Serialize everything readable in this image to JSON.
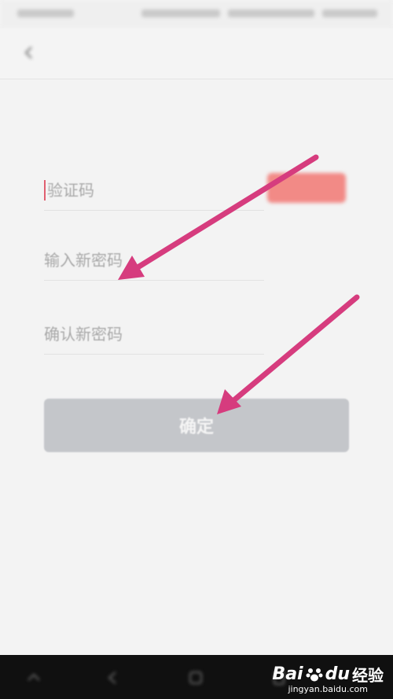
{
  "status_bar": {
    "carrier": "",
    "time": ""
  },
  "header": {
    "title": "",
    "back_icon": "chevron-left-icon"
  },
  "form": {
    "phone_hint": "",
    "code_placeholder": "验证码",
    "send_code_label": "",
    "new_password_placeholder": "输入新密码",
    "confirm_password_placeholder": "确认新密码",
    "confirm_label": "确定"
  },
  "colors": {
    "send_code_button": "#f28a86",
    "confirm_button": "#c4c6ca",
    "annotation_arrow": "#d63c7e",
    "nav_bar": "#101010"
  },
  "watermark": {
    "brand_a": "Bai",
    "brand_b": "du",
    "brand_c": "经验",
    "url": "jingyan.baidu.com"
  }
}
